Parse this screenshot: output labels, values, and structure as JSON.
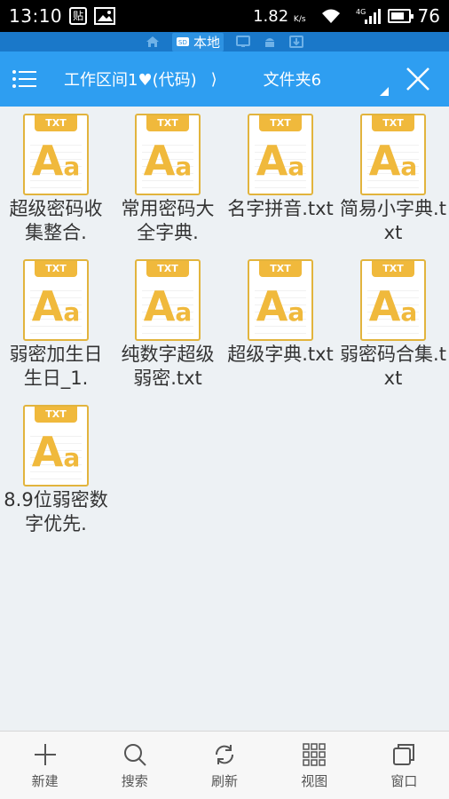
{
  "status_bar": {
    "time": "13:10",
    "speed": "1.82",
    "speed_unit": "K/s",
    "network": "4G",
    "battery": "76",
    "battery_level": 0.76
  },
  "location_strip": {
    "active_label": "本地"
  },
  "header": {
    "breadcrumb": "工作区间1♥(代码)",
    "breadcrumb_separator": "⟩",
    "folder_title": "文件夹6"
  },
  "files": [
    {
      "type": "TXT",
      "name": "超级密码收集整合."
    },
    {
      "type": "TXT",
      "name": "常用密码大全字典."
    },
    {
      "type": "TXT",
      "name": "名字拼音.txt"
    },
    {
      "type": "TXT",
      "name": "简易小字典.txt"
    },
    {
      "type": "TXT",
      "name": "弱密加生日生日_1."
    },
    {
      "type": "TXT",
      "name": "纯数字超级弱密.txt"
    },
    {
      "type": "TXT",
      "name": "超级字典.txt"
    },
    {
      "type": "TXT",
      "name": "弱密码合集.txt"
    },
    {
      "type": "TXT",
      "name": "8.9位弱密数字优先."
    }
  ],
  "bottom_bar": {
    "new": "新建",
    "search": "搜索",
    "refresh": "刷新",
    "view": "视图",
    "window": "窗口"
  },
  "colors": {
    "header_bg": "#2e9ef1",
    "strip_bg": "#1a78c9",
    "file_accent": "#f0b93c",
    "page_bg": "#edf1f4"
  }
}
